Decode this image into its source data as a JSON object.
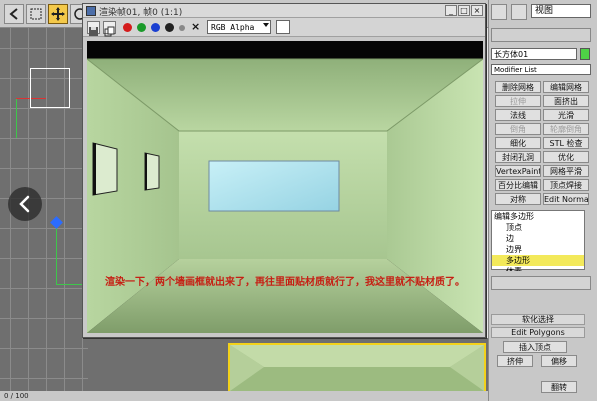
{
  "render_window": {
    "title": "渲染帧01, 帧0 (1:1)",
    "channel": "RGB Alpha",
    "caption": "渲染一下，两个墙画框就出来了，再往里面贴材质就行了，我这里就不贴材质了。",
    "title_buttons": [
      "_",
      "□",
      "×"
    ],
    "close_channel_label": "×"
  },
  "command_panel": {
    "view_dropdown": "视图",
    "object_name": "长方体01",
    "modifier_list": "Modifier List",
    "buttons": [
      [
        "删除网格",
        "编辑网格"
      ],
      [
        "拉伸",
        "面挤出"
      ],
      [
        "法线",
        "光滑"
      ],
      [
        "倒角",
        "轮廓倒角"
      ],
      [
        "细化",
        "STL 检查"
      ],
      [
        "封闭孔洞",
        "优化"
      ],
      [
        "VertexPaint",
        "网格平滑"
      ],
      [
        "百分比编辑",
        "顶点焊接"
      ],
      [
        "对称",
        "Edit Normal"
      ]
    ],
    "stack": [
      "编辑多边形",
      "顶点",
      "边",
      "边界",
      "多边形",
      "体素"
    ],
    "sections": [
      "软化选择",
      "Edit Polygons"
    ],
    "insert_vertex": "插入顶点",
    "extrude": "挤伸",
    "move": "偏移",
    "bottom_button": "翻转"
  },
  "status": {
    "frame": "0 / 100"
  },
  "icons": [
    "back-arrow-icon",
    "select-icon",
    "region-select-icon",
    "move-icon",
    "rotate-icon",
    "save-icon",
    "copy-icon",
    "delete-icon",
    "prev-chevron-icon"
  ],
  "colors": {
    "selected": "#f3e95a",
    "caption": "#c61f14",
    "room": "#a8c98f",
    "window_glow": "#a7e0ec"
  }
}
